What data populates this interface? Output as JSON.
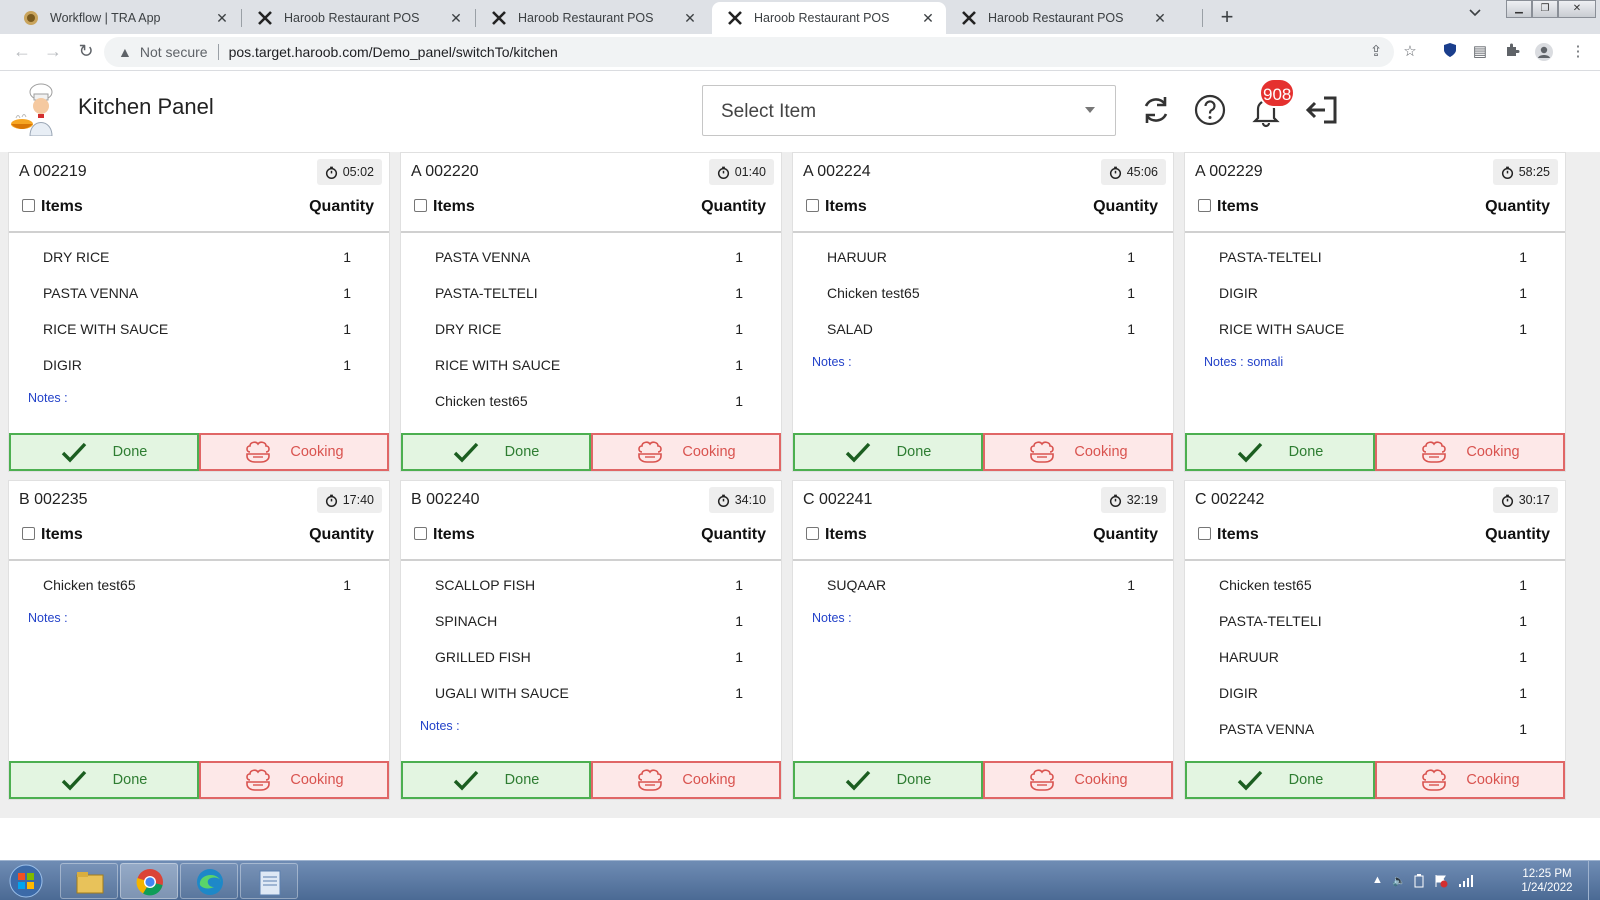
{
  "browser": {
    "tabs": [
      {
        "title": "Workflow | TRA App",
        "icon": "tra-app-favicon",
        "active": false
      },
      {
        "title": "Haroob Restaurant POS",
        "icon": "haroob-favicon",
        "active": false
      },
      {
        "title": "Haroob Restaurant POS",
        "icon": "haroob-favicon",
        "active": false
      },
      {
        "title": "Haroob Restaurant POS",
        "icon": "haroob-favicon",
        "active": true
      },
      {
        "title": "Haroob Restaurant POS",
        "icon": "haroob-favicon",
        "active": false
      }
    ],
    "new_tab_label": "+",
    "security_label": "Not secure",
    "url": "pos.target.haroob.com/Demo_panel/switchTo/kitchen"
  },
  "app": {
    "title": "Kitchen Panel",
    "select_placeholder": "Select Item",
    "notification_count": "908",
    "icons": [
      "refresh-icon",
      "help-icon",
      "bell-icon",
      "logout-icon"
    ]
  },
  "labels": {
    "items": "Items",
    "quantity": "Quantity",
    "done": "Done",
    "cooking": "Cooking"
  },
  "orders": [
    {
      "id": "A 002219",
      "timer": "05:02",
      "items": [
        {
          "name": "DRY RICE",
          "qty": "1"
        },
        {
          "name": "PASTA VENNA",
          "qty": "1"
        },
        {
          "name": "RICE WITH SAUCE",
          "qty": "1"
        },
        {
          "name": "DIGIR",
          "qty": "1"
        }
      ],
      "notes": "Notes :"
    },
    {
      "id": "A 002220",
      "timer": "01:40",
      "items": [
        {
          "name": "PASTA VENNA",
          "qty": "1"
        },
        {
          "name": "PASTA-TELTELI",
          "qty": "1"
        },
        {
          "name": "DRY RICE",
          "qty": "1"
        },
        {
          "name": "RICE WITH SAUCE",
          "qty": "1"
        },
        {
          "name": "Chicken test65",
          "qty": "1"
        }
      ],
      "notes": ""
    },
    {
      "id": "A 002224",
      "timer": "45:06",
      "items": [
        {
          "name": "HARUUR",
          "qty": "1"
        },
        {
          "name": "Chicken test65",
          "qty": "1"
        },
        {
          "name": "SALAD",
          "qty": "1"
        }
      ],
      "notes": "Notes :"
    },
    {
      "id": "A 002229",
      "timer": "58:25",
      "items": [
        {
          "name": "PASTA-TELTELI",
          "qty": "1"
        },
        {
          "name": "DIGIR",
          "qty": "1"
        },
        {
          "name": "RICE WITH SAUCE",
          "qty": "1"
        }
      ],
      "notes": "Notes : somali"
    },
    {
      "id": "B 002235",
      "timer": "17:40",
      "items": [
        {
          "name": "Chicken test65",
          "qty": "1"
        }
      ],
      "notes": "Notes :"
    },
    {
      "id": "B 002240",
      "timer": "34:10",
      "items": [
        {
          "name": "SCALLOP FISH",
          "qty": "1"
        },
        {
          "name": "SPINACH",
          "qty": "1"
        },
        {
          "name": "GRILLED FISH",
          "qty": "1"
        },
        {
          "name": "UGALI WITH SAUCE",
          "qty": "1"
        }
      ],
      "notes": "Notes :"
    },
    {
      "id": "C 002241",
      "timer": "32:19",
      "items": [
        {
          "name": "SUQAAR",
          "qty": "1"
        }
      ],
      "notes": "Notes :"
    },
    {
      "id": "C 002242",
      "timer": "30:17",
      "items": [
        {
          "name": "Chicken test65",
          "qty": "1"
        },
        {
          "name": "PASTA-TELTELI",
          "qty": "1"
        },
        {
          "name": "HARUUR",
          "qty": "1"
        },
        {
          "name": "DIGIR",
          "qty": "1"
        },
        {
          "name": "PASTA VENNA",
          "qty": "1"
        }
      ],
      "notes": ""
    }
  ],
  "taskbar": {
    "time": "12:25 PM",
    "date": "1/24/2022",
    "apps": [
      "file-explorer-icon",
      "chrome-icon",
      "edge-icon",
      "notepad-icon"
    ]
  },
  "colors": {
    "done_border": "#4caf50",
    "done_bg": "#e3f5e1",
    "cooking_border": "#e06666",
    "cooking_bg": "#fde8e8",
    "notes_text": "#2342c9",
    "badge": "#e5312f"
  }
}
